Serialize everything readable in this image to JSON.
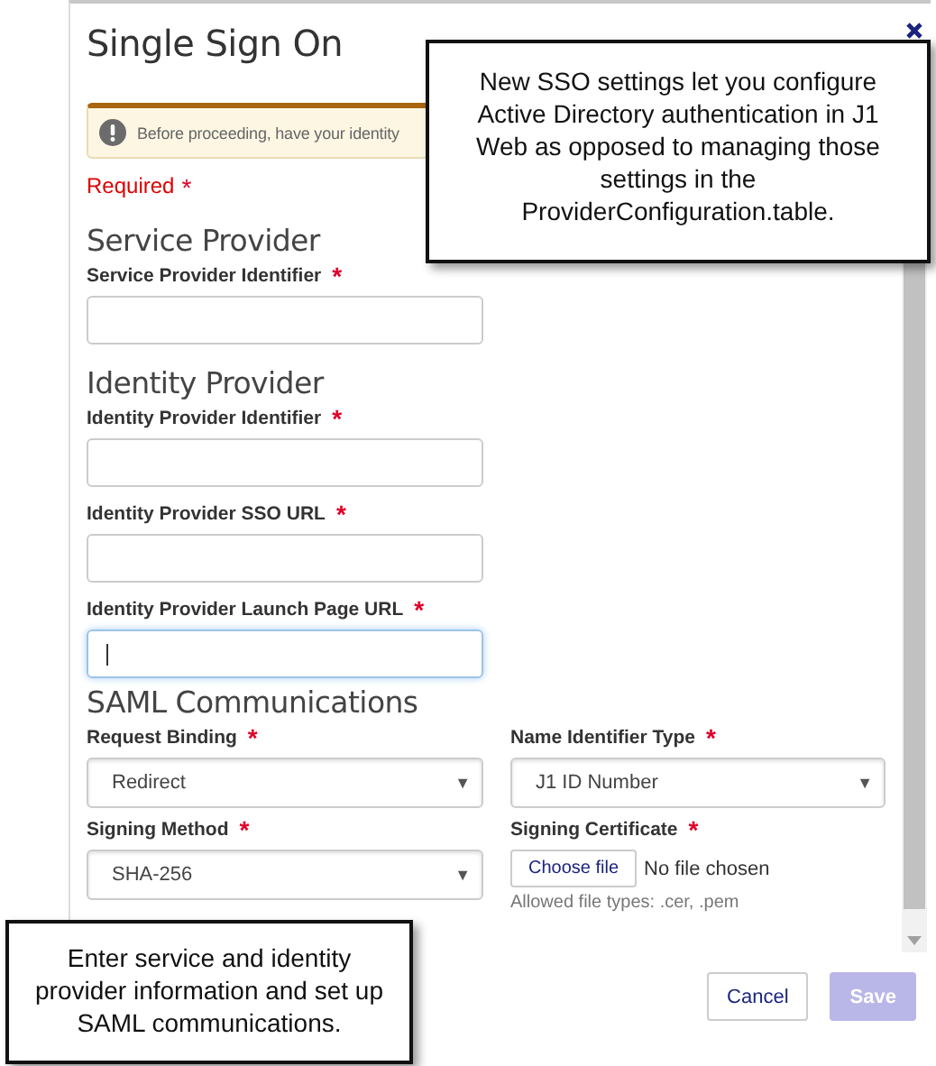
{
  "dialog": {
    "title": "Single Sign On",
    "alert": "Before proceeding, have your identity",
    "required_note": "Required",
    "required_mark": "*",
    "sections": [
      {
        "heading": "Service Provider",
        "fields": [
          {
            "kind": "text",
            "label": "Service Provider Identifier",
            "required": true,
            "focused": false
          }
        ]
      },
      {
        "heading": "Identity Provider",
        "fields": [
          {
            "kind": "text",
            "label": "Identity Provider Identifier",
            "required": true,
            "focused": false
          },
          {
            "kind": "text",
            "label": "Identity Provider SSO URL",
            "required": true,
            "focused": false
          },
          {
            "kind": "text",
            "label": "Identity Provider Launch Page URL",
            "required": true,
            "focused": true
          }
        ]
      },
      {
        "heading": "SAML Communications",
        "fields": [
          {
            "kind": "select",
            "label": "Request Binding",
            "required": true,
            "value": "Redirect",
            "arrow": "▼"
          },
          {
            "kind": "select",
            "label": "Name Identifier Type",
            "required": true,
            "value": "J1 ID Number",
            "arrow": "▼"
          },
          {
            "kind": "select",
            "label": "Signing Method",
            "required": true,
            "value": "SHA-256",
            "arrow": "▼"
          },
          {
            "kind": "file",
            "label": "Signing Certificate",
            "required": true,
            "button": "Choose file",
            "status": "No file chosen",
            "hint": "Allowed file types: .cer, .pem"
          }
        ]
      }
    ],
    "buttons": [
      {
        "label": "Cancel",
        "disabled": false
      },
      {
        "label": "Save",
        "disabled": true
      }
    ]
  },
  "callouts": [
    {
      "text": "New SSO settings let you configure Active Directory authentication in J1 Web as opposed to managing those settings in the ProviderConfiguration.table."
    },
    {
      "text": "Enter service and identity provider information and set up SAML communications."
    }
  ]
}
